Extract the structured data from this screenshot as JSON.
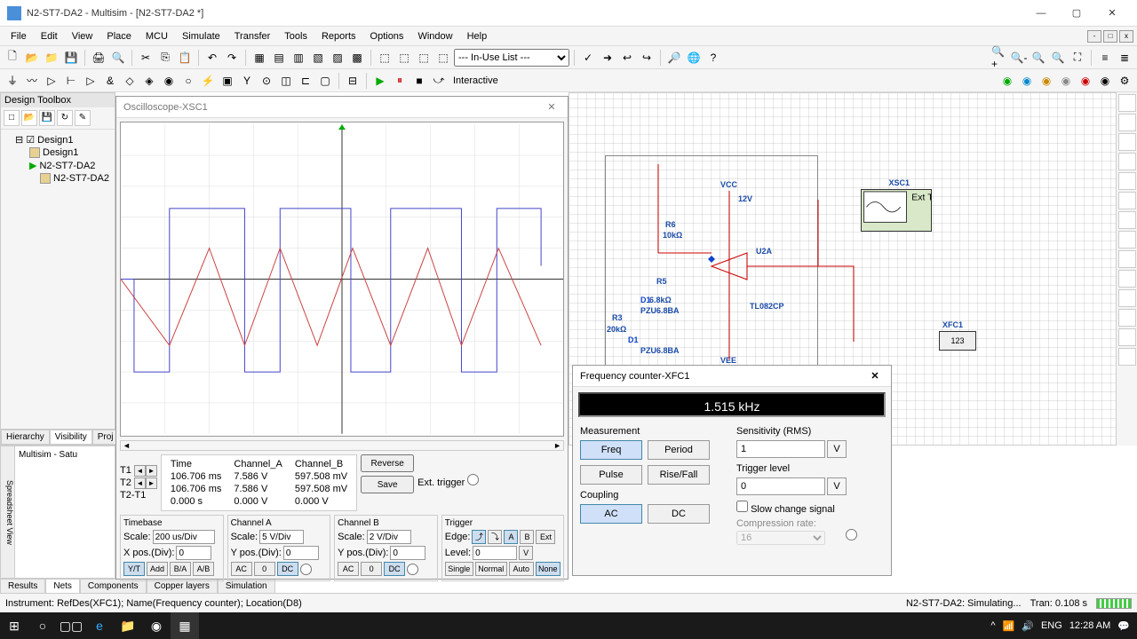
{
  "window": {
    "title": "N2-ST7-DA2 - Multisim - [N2-ST7-DA2 *]"
  },
  "menu": {
    "items": [
      "File",
      "Edit",
      "View",
      "Place",
      "MCU",
      "Simulate",
      "Transfer",
      "Tools",
      "Reports",
      "Options",
      "Window",
      "Help"
    ]
  },
  "toolbar2_select": "--- In-Use List ---",
  "design_toolbox": {
    "title": "Design Toolbox",
    "root": "Design1",
    "items": [
      "Design1",
      "N2-ST7-DA2",
      "N2-ST7-DA2"
    ],
    "tabs": [
      "Hierarchy",
      "Visibility",
      "Proj"
    ]
  },
  "schematic": {
    "vcc": "VCC",
    "vcc_val": "12V",
    "r6": "R6",
    "r6_val": "10kΩ",
    "r5": "R5",
    "r5_val": "6.8kΩ",
    "r3": "R3",
    "r3_val": "20kΩ",
    "d1a": "D1",
    "d1a_val": "PZU6.8BA",
    "d1b": "D1",
    "d1b_val": "PZU6.8BA",
    "u2a": "U2A",
    "ic": "TL082CP",
    "vee": "VEE",
    "xsc1": "XSC1",
    "xfc1": "XFC1",
    "xfc1_val": "123"
  },
  "oscilloscope": {
    "title": "Oscilloscope-XSC1",
    "readout": {
      "headers": [
        "",
        "Time",
        "Channel_A",
        "Channel_B"
      ],
      "t1": [
        "T1",
        "106.706 ms",
        "7.586 V",
        "597.508 mV"
      ],
      "t2": [
        "T2",
        "106.706 ms",
        "7.586 V",
        "597.508 mV"
      ],
      "dt": [
        "T2-T1",
        "0.000 s",
        "0.000 V",
        "0.000 V"
      ]
    },
    "reverse": "Reverse",
    "save": "Save",
    "ext_trigger": "Ext. trigger",
    "timebase": {
      "title": "Timebase",
      "scale_label": "Scale:",
      "scale": "200 us/Div",
      "xpos_label": "X pos.(Div):",
      "xpos": "0",
      "yt": "Y/T",
      "add": "Add",
      "ba": "B/A",
      "ab": "A/B"
    },
    "chA": {
      "title": "Channel A",
      "scale_label": "Scale:",
      "scale": "5 V/Div",
      "ypos_label": "Y pos.(Div):",
      "ypos": "0",
      "ac": "AC",
      "zero": "0",
      "dc": "DC"
    },
    "chB": {
      "title": "Channel B",
      "scale_label": "Scale:",
      "scale": "2 V/Div",
      "ypos_label": "Y pos.(Div):",
      "ypos": "0",
      "ac": "AC",
      "zero": "0",
      "dc": "DC"
    },
    "trigger": {
      "title": "Trigger",
      "edge_label": "Edge:",
      "a": "A",
      "b": "B",
      "ext": "Ext",
      "level_label": "Level:",
      "level": "0",
      "unit": "V",
      "single": "Single",
      "normal": "Normal",
      "auto": "Auto",
      "none": "None"
    }
  },
  "freq_counter": {
    "title": "Frequency counter-XFC1",
    "reading": "1.515 kHz",
    "measurement": {
      "title": "Measurement",
      "freq": "Freq",
      "period": "Period",
      "pulse": "Pulse",
      "risefall": "Rise/Fall"
    },
    "coupling": {
      "title": "Coupling",
      "ac": "AC",
      "dc": "DC"
    },
    "sensitivity": {
      "title": "Sensitivity (RMS)",
      "value": "1",
      "unit": "V"
    },
    "trigger": {
      "title": "Trigger level",
      "value": "0",
      "unit": "V"
    },
    "slow": "Slow change signal",
    "compression_label": "Compression rate:",
    "compression": "16"
  },
  "spreadsheet": {
    "side": "Spreadsheet View",
    "text": "Multisim  -  Satu"
  },
  "bottom_tabs": [
    "Results",
    "Nets",
    "Components",
    "Copper layers",
    "Simulation"
  ],
  "status": {
    "left": "Instrument: RefDes(XFC1); Name(Frequency counter); Location(D8)",
    "sim": "N2-ST7-DA2: Simulating...",
    "tran": "Tran: 0.108 s"
  },
  "interactive": "Interactive",
  "taskbar": {
    "lang": "ENG",
    "time": "12:28 AM",
    "date": ""
  }
}
